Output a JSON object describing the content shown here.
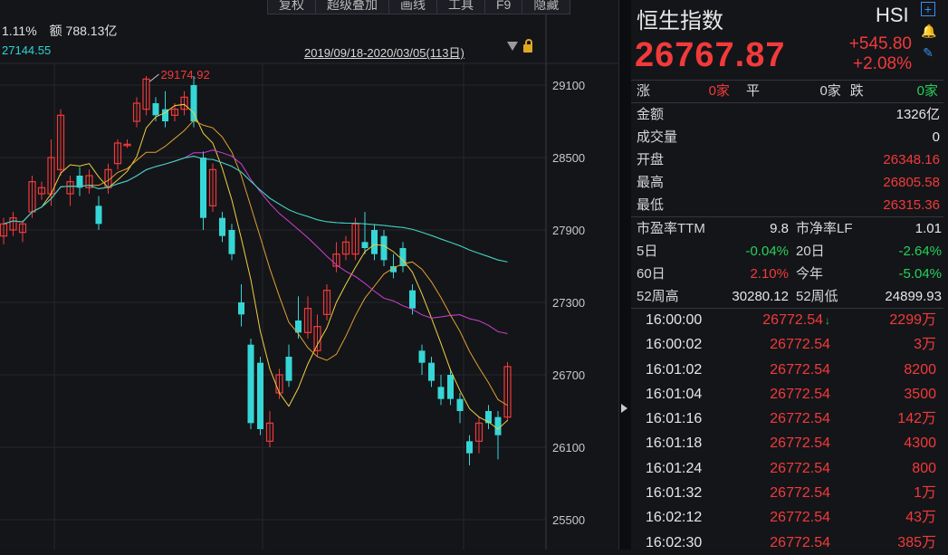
{
  "toolbar": {
    "buttons": [
      "复权",
      "超级叠加",
      "画线",
      "工具",
      "F9",
      "隐藏"
    ]
  },
  "chart_info": {
    "change_pct": "1.11%",
    "amount": "额 788.13亿",
    "ma_value": "27144.55",
    "date_range": "2019/09/18-2020/03/05(113日)",
    "high_label": "29174.92"
  },
  "chart_data": {
    "type": "candlestick",
    "y_ticks": [
      "29100",
      "28500",
      "27900",
      "27300",
      "26700",
      "26100",
      "25500"
    ],
    "y_tick_values": [
      29100,
      28500,
      27900,
      27300,
      26700,
      26100,
      25500
    ],
    "ylim": [
      25300,
      29500
    ],
    "candles": [
      {
        "o": 27850,
        "c": 27950,
        "h": 28000,
        "l": 27780
      },
      {
        "o": 27900,
        "c": 28000,
        "h": 28050,
        "l": 27850
      },
      {
        "o": 27880,
        "c": 27950,
        "h": 27980,
        "l": 27800
      },
      {
        "o": 28050,
        "c": 28300,
        "h": 28350,
        "l": 28000
      },
      {
        "o": 28200,
        "c": 28250,
        "h": 28300,
        "l": 28150
      },
      {
        "o": 28200,
        "c": 28500,
        "h": 28650,
        "l": 28100
      },
      {
        "o": 28400,
        "c": 28850,
        "h": 28900,
        "l": 28350
      },
      {
        "o": 28200,
        "c": 28300,
        "h": 28350,
        "l": 28100
      },
      {
        "o": 28350,
        "c": 28250,
        "h": 28420,
        "l": 28180
      },
      {
        "o": 28250,
        "c": 28350,
        "h": 28400,
        "l": 28200
      },
      {
        "o": 28100,
        "c": 27950,
        "h": 28180,
        "l": 27900
      },
      {
        "o": 28250,
        "c": 28400,
        "h": 28450,
        "l": 28200
      },
      {
        "o": 28450,
        "c": 28620,
        "h": 28650,
        "l": 28400
      },
      {
        "o": 28600,
        "c": 28610,
        "h": 28650,
        "l": 28580
      },
      {
        "o": 28800,
        "c": 28950,
        "h": 29000,
        "l": 28750
      },
      {
        "o": 28900,
        "c": 29150,
        "h": 29175,
        "l": 28850
      },
      {
        "o": 28950,
        "c": 28850,
        "h": 29000,
        "l": 28800
      },
      {
        "o": 28900,
        "c": 28800,
        "h": 29050,
        "l": 28750
      },
      {
        "o": 28850,
        "c": 28900,
        "h": 28950,
        "l": 28800
      },
      {
        "o": 28900,
        "c": 29000,
        "h": 29050,
        "l": 28850
      },
      {
        "o": 29100,
        "c": 28800,
        "h": 29175,
        "l": 28750
      },
      {
        "o": 28500,
        "c": 28000,
        "h": 28550,
        "l": 27900
      },
      {
        "o": 28100,
        "c": 28400,
        "h": 28450,
        "l": 28050
      },
      {
        "o": 28000,
        "c": 27850,
        "h": 28050,
        "l": 27800
      },
      {
        "o": 27900,
        "c": 27700,
        "h": 27950,
        "l": 27650
      },
      {
        "o": 27300,
        "c": 27200,
        "h": 27450,
        "l": 27100
      },
      {
        "o": 26950,
        "c": 26300,
        "h": 27000,
        "l": 26250
      },
      {
        "o": 26800,
        "c": 26250,
        "h": 26850,
        "l": 26200
      },
      {
        "o": 26150,
        "c": 26300,
        "h": 26400,
        "l": 26100
      },
      {
        "o": 26550,
        "c": 26700,
        "h": 26750,
        "l": 26500
      },
      {
        "o": 26850,
        "c": 26650,
        "h": 26950,
        "l": 26600
      },
      {
        "o": 27150,
        "c": 27050,
        "h": 27350,
        "l": 27000
      },
      {
        "o": 27050,
        "c": 27250,
        "h": 27350,
        "l": 27000
      },
      {
        "o": 26900,
        "c": 27100,
        "h": 27200,
        "l": 26850
      },
      {
        "o": 27200,
        "c": 27400,
        "h": 27450,
        "l": 27150
      },
      {
        "o": 27600,
        "c": 27700,
        "h": 27800,
        "l": 27550
      },
      {
        "o": 27700,
        "c": 27800,
        "h": 27850,
        "l": 27650
      },
      {
        "o": 27700,
        "c": 27950,
        "h": 28000,
        "l": 27650
      },
      {
        "o": 27800,
        "c": 27750,
        "h": 28050,
        "l": 27700
      },
      {
        "o": 27900,
        "c": 27700,
        "h": 27950,
        "l": 27650
      },
      {
        "o": 27850,
        "c": 27650,
        "h": 27900,
        "l": 27600
      },
      {
        "o": 27600,
        "c": 27550,
        "h": 27700,
        "l": 27500
      },
      {
        "o": 27750,
        "c": 27600,
        "h": 27800,
        "l": 27550
      },
      {
        "o": 27400,
        "c": 27250,
        "h": 27450,
        "l": 27200
      },
      {
        "o": 26900,
        "c": 26800,
        "h": 26950,
        "l": 26700
      },
      {
        "o": 26800,
        "c": 26650,
        "h": 26850,
        "l": 26600
      },
      {
        "o": 26600,
        "c": 26500,
        "h": 26700,
        "l": 26450
      },
      {
        "o": 26700,
        "c": 26500,
        "h": 26750,
        "l": 26450
      },
      {
        "o": 26500,
        "c": 26400,
        "h": 26550,
        "l": 26300
      },
      {
        "o": 26150,
        "c": 26050,
        "h": 26200,
        "l": 25950
      },
      {
        "o": 26150,
        "c": 26300,
        "h": 26350,
        "l": 26050
      },
      {
        "o": 26400,
        "c": 26300,
        "h": 26450,
        "l": 26250
      },
      {
        "o": 26350,
        "c": 26200,
        "h": 26400,
        "l": 26000
      },
      {
        "o": 26350,
        "c": 26768,
        "h": 26806,
        "l": 26315
      }
    ]
  },
  "quote": {
    "name": "恒生指数",
    "code": "HSI",
    "price": "26767.87",
    "change": "+545.80",
    "change_pct": "+2.08%"
  },
  "breadth": {
    "up_label": "涨",
    "up_val": "0家",
    "flat_label": "平",
    "flat_val": "0家",
    "down_label": "跌",
    "down_val": "0家"
  },
  "stats": [
    {
      "label": "金额",
      "value": "1326亿",
      "color": "white"
    },
    {
      "label": "成交量",
      "value": "0",
      "color": "white"
    },
    {
      "label": "开盘",
      "value": "26348.16",
      "color": "red"
    },
    {
      "label": "最高",
      "value": "26805.58",
      "color": "red"
    },
    {
      "label": "最低",
      "value": "26315.36",
      "color": "red"
    }
  ],
  "ratios": [
    {
      "l1": "市盈率TTM",
      "v1": "9.8",
      "c1": "white",
      "l2": "市净率LF",
      "v2": "1.01",
      "c2": "white"
    },
    {
      "l1": "5日",
      "v1": "-0.04%",
      "c1": "green",
      "l2": "20日",
      "v2": "-2.64%",
      "c2": "green"
    },
    {
      "l1": "60日",
      "v1": "2.10%",
      "c1": "red",
      "l2": "今年",
      "v2": "-5.04%",
      "c2": "green"
    },
    {
      "l1": "52周高",
      "v1": "30280.12",
      "c1": "white",
      "l2": "52周低",
      "v2": "24899.93",
      "c2": "white"
    }
  ],
  "ticks": [
    {
      "time": "16:00:00",
      "price": "26772.54",
      "vol": "2299万",
      "arrow": true
    },
    {
      "time": "16:00:02",
      "price": "26772.54",
      "vol": "3万"
    },
    {
      "time": "16:01:02",
      "price": "26772.54",
      "vol": "8200"
    },
    {
      "time": "16:01:04",
      "price": "26772.54",
      "vol": "3500"
    },
    {
      "time": "16:01:16",
      "price": "26772.54",
      "vol": "142万"
    },
    {
      "time": "16:01:18",
      "price": "26772.54",
      "vol": "4300"
    },
    {
      "time": "16:01:24",
      "price": "26772.54",
      "vol": "800"
    },
    {
      "time": "16:01:32",
      "price": "26772.54",
      "vol": "1万"
    },
    {
      "time": "16:02:12",
      "price": "26772.54",
      "vol": "43万"
    },
    {
      "time": "16:02:30",
      "price": "26772.54",
      "vol": "385万"
    }
  ]
}
